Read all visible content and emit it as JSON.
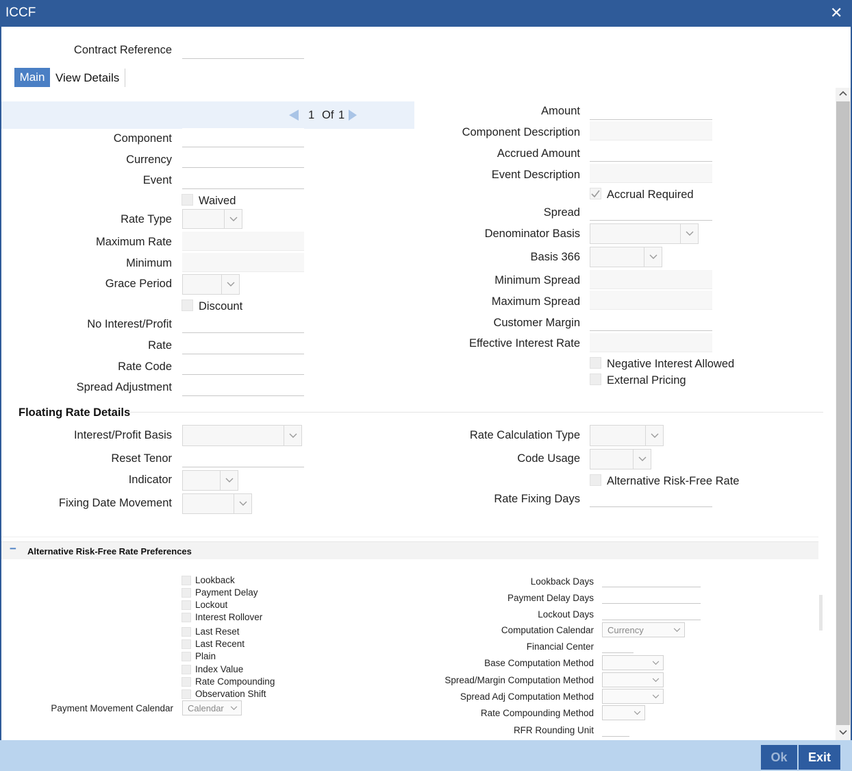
{
  "window": {
    "title": "ICCF",
    "close_glyph": "✕"
  },
  "header": {
    "contract_reference_label": "Contract Reference"
  },
  "tabs": [
    {
      "label": "Main"
    },
    {
      "label": "View Details"
    }
  ],
  "pager": {
    "current": "1",
    "of_label": "Of",
    "total": "1"
  },
  "left_fields": {
    "component": "Component",
    "currency": "Currency",
    "event": "Event",
    "waived": "Waived",
    "rate_type": "Rate Type",
    "maximum_rate": "Maximum Rate",
    "minimum": "Minimum",
    "grace_period": "Grace Period",
    "discount": "Discount",
    "no_interest_profit": "No Interest/Profit",
    "rate": "Rate",
    "rate_code": "Rate Code",
    "spread_adjustment": "Spread Adjustment"
  },
  "right_fields": {
    "amount": "Amount",
    "component_description": "Component Description",
    "accrued_amount": "Accrued Amount",
    "event_description": "Event Description",
    "accrual_required": "Accrual Required",
    "spread": "Spread",
    "denominator_basis": "Denominator Basis",
    "basis_366": "Basis 366",
    "minimum_spread": "Minimum Spread",
    "maximum_spread": "Maximum Spread",
    "customer_margin": "Customer Margin",
    "effective_interest_rate": "Effective Interest Rate",
    "negative_interest_allowed": "Negative Interest Allowed",
    "external_pricing": "External Pricing"
  },
  "floating": {
    "title": "Floating Rate Details",
    "interest_profit_basis": "Interest/Profit Basis",
    "reset_tenor": "Reset Tenor",
    "indicator": "Indicator",
    "fixing_date_movement": "Fixing Date Movement",
    "rate_calculation_type": "Rate Calculation Type",
    "code_usage": "Code Usage",
    "alternative_risk_free_rate": "Alternative Risk-Free Rate",
    "rate_fixing_days": "Rate Fixing Days"
  },
  "arfr": {
    "title": "Alternative Risk-Free Rate Preferences",
    "collapse_glyph": "−",
    "checkboxes": [
      "Lookback",
      "Payment Delay",
      "Lockout",
      "Interest Rollover",
      "Last Reset",
      "Last Recent",
      "Plain",
      "Index Value",
      "Rate Compounding",
      "Observation Shift"
    ],
    "payment_movement_calendar": "Payment Movement Calendar",
    "payment_movement_calendar_value": "Calendar",
    "lookback_days": "Lookback Days",
    "payment_delay_days": "Payment Delay Days",
    "lockout_days": "Lockout Days",
    "computation_calendar": "Computation Calendar",
    "computation_calendar_value": "Currency",
    "financial_center": "Financial Center",
    "base_computation_method": "Base Computation Method",
    "spread_margin_computation_method": "Spread/Margin Computation Method",
    "spread_adj_computation_method": "Spread Adj Computation Method",
    "rate_compounding_method": "Rate Compounding Method",
    "rfr_rounding_unit": "RFR Rounding Unit"
  },
  "footer": {
    "ok_label": "Ok",
    "exit_label": "Exit"
  },
  "colors": {
    "titlebar": "#2f5b99",
    "tab_active": "#4a7fc4",
    "footer": "#bad4ee",
    "button": "#2d5ca0",
    "pager_bar": "#eaf1fa"
  },
  "icons": {
    "close": "close-icon",
    "prev": "triangle-left-icon",
    "next": "triangle-right-icon",
    "dropdown": "chevron-down-icon",
    "check": "checkmark-icon",
    "scroll_up": "chevron-up-icon",
    "scroll_down": "chevron-down-icon"
  }
}
